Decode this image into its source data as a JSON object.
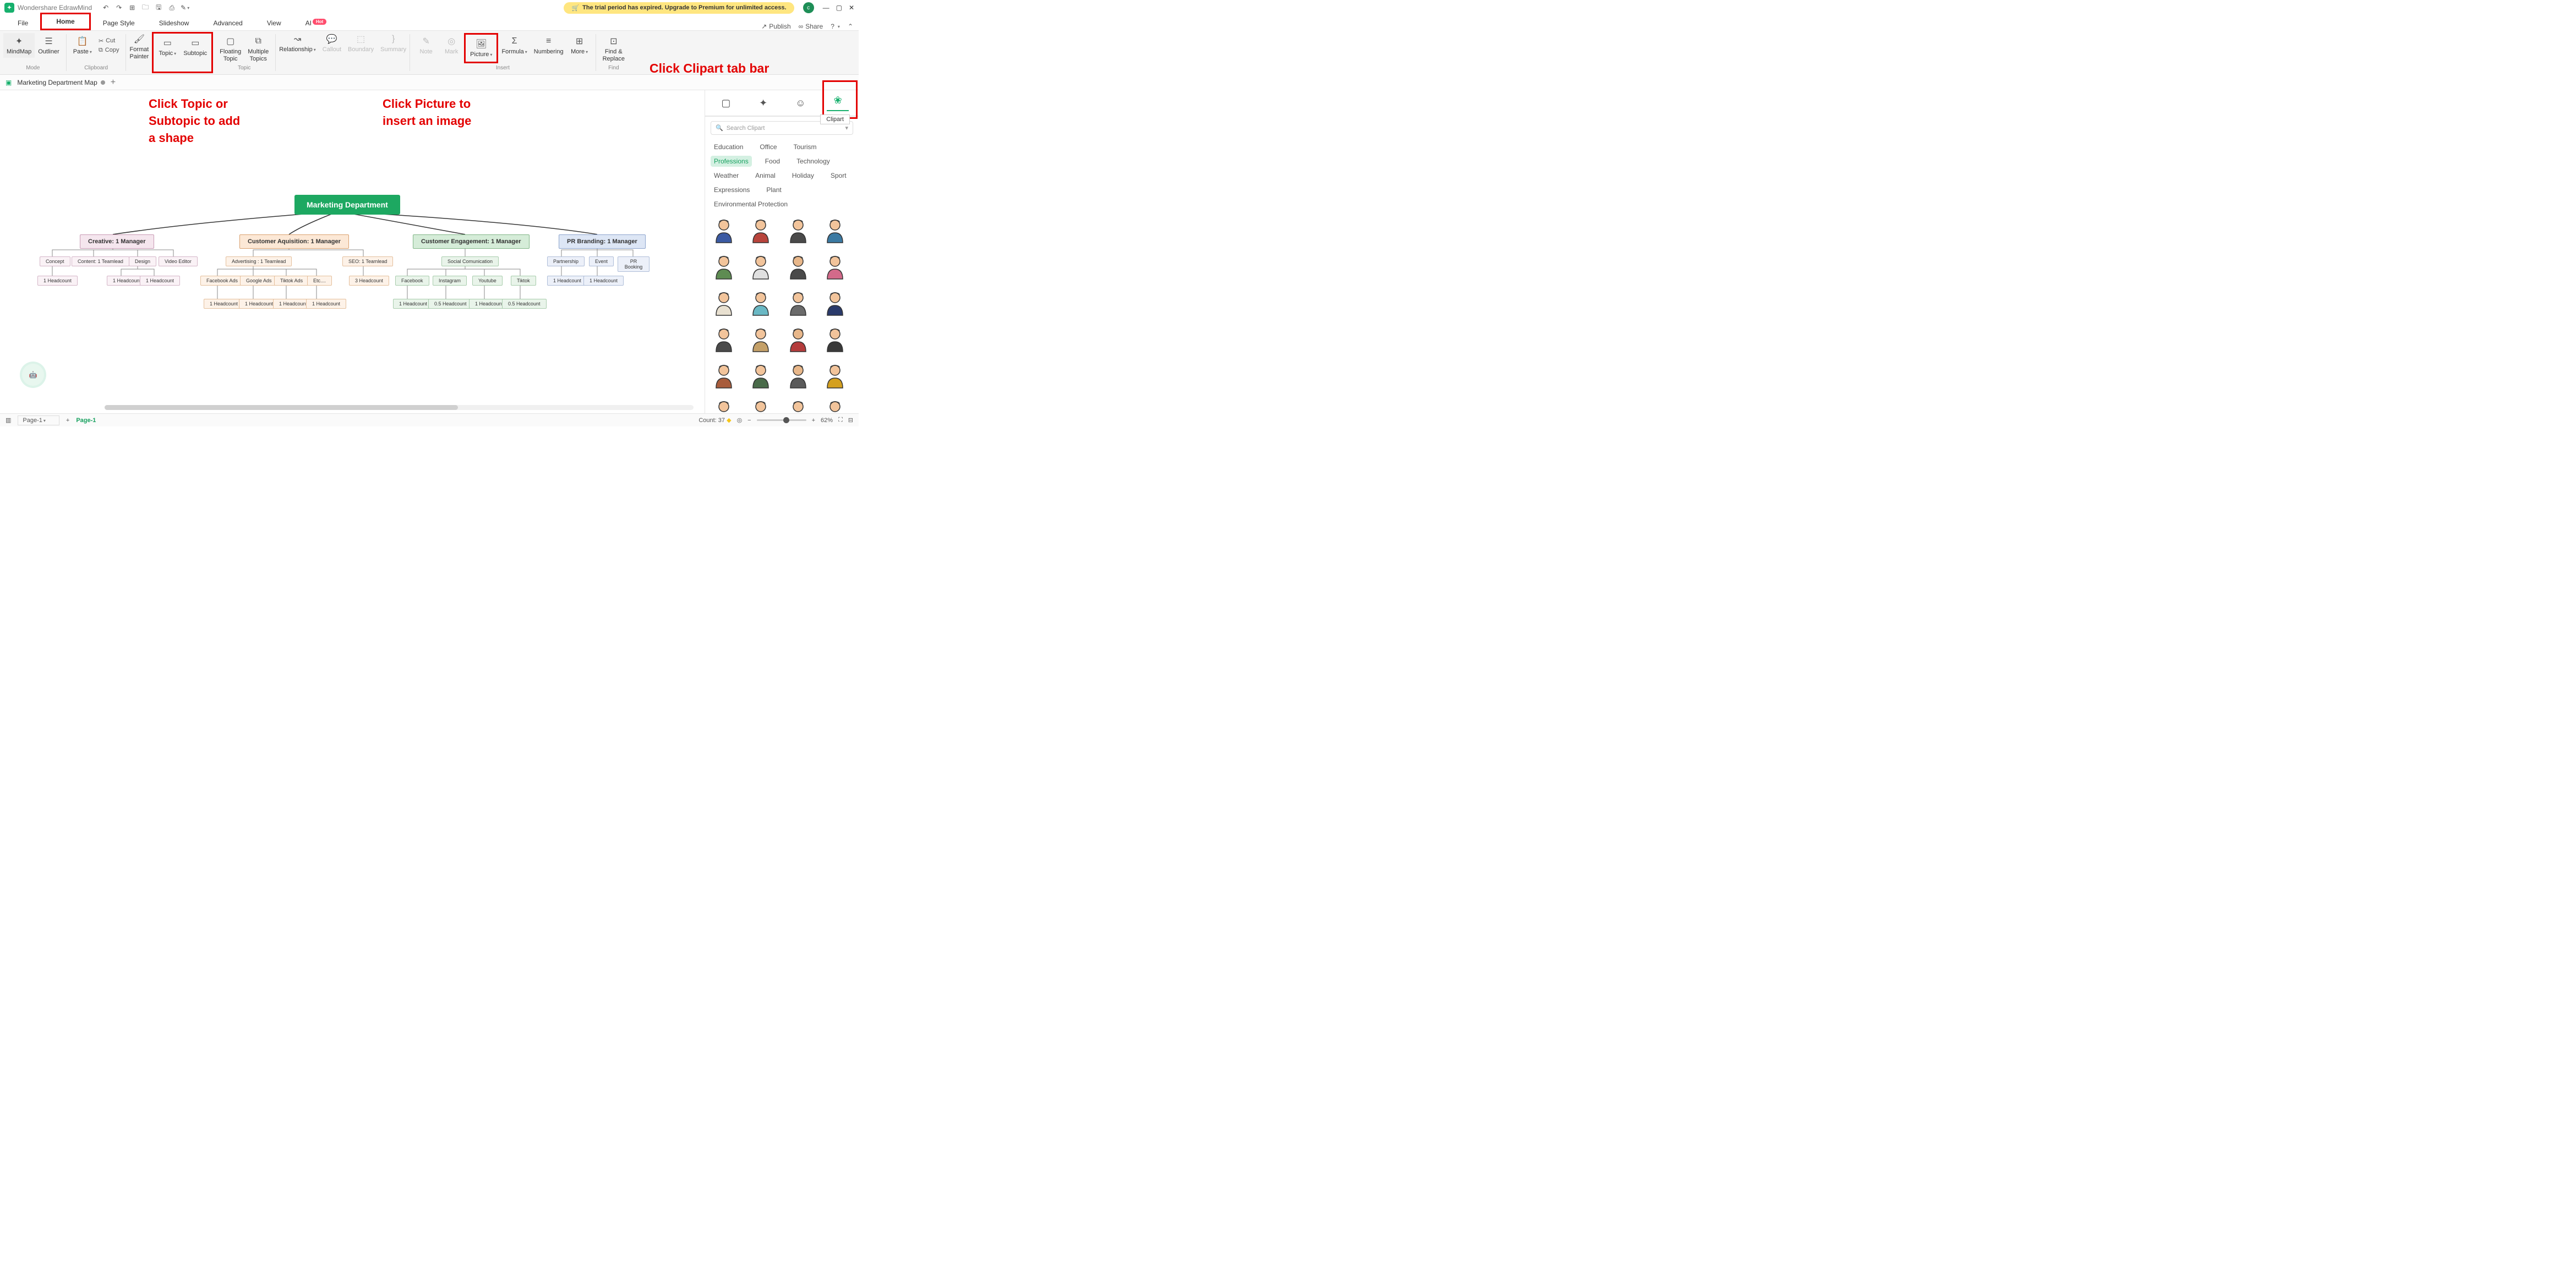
{
  "titlebar": {
    "app": "Wondershare EdrawMind",
    "avatar": "c",
    "trial": "The trial period has expired. Upgrade to Premium for unlimited access."
  },
  "menu": {
    "file": "File",
    "home": "Home",
    "page_style": "Page Style",
    "slideshow": "Slideshow",
    "advanced": "Advanced",
    "view": "View",
    "ai": "AI",
    "hot": "Hot",
    "publish": "Publish",
    "share": "Share"
  },
  "ribbon": {
    "mindmap": "MindMap",
    "outliner": "Outliner",
    "mode": "Mode",
    "paste": "Paste",
    "cut": "Cut",
    "copy": "Copy",
    "clipboard": "Clipboard",
    "format_painter": "Format\nPainter",
    "topic": "Topic",
    "subtopic": "Subtopic",
    "floating": "Floating\nTopic",
    "multiple": "Multiple\nTopics",
    "topic_group": "Topic",
    "relationship": "Relationship",
    "callout": "Callout",
    "boundary": "Boundary",
    "summary": "Summary",
    "note": "Note",
    "mark": "Mark",
    "picture": "Picture",
    "formula": "Formula",
    "numbering": "Numbering",
    "more": "More",
    "insert": "Insert",
    "find_replace": "Find &\nReplace",
    "find": "Find"
  },
  "doc_tabs": {
    "name": "Marketing Department Map"
  },
  "annotations": {
    "a1": "Click Topic or Subtopic to add a shape",
    "a2": "Click Picture to insert an image",
    "a3": "Click Clipart tab bar"
  },
  "mindmap": {
    "root": "Marketing Department",
    "mgr": {
      "creative": "Creative: 1 Manager",
      "cust_aq": "Customer Aquisition: 1 Manager",
      "cust_en": "Customer Engagement: 1 Manager",
      "pr": "PR Branding: 1 Manager"
    },
    "sub": {
      "concept": "Concept",
      "content": "Content: 1 Teamlead",
      "design": "Design",
      "video": "Video Editor",
      "hc1": "1 Headcount",
      "advertising": "Advertising : 1 Teamlead",
      "seo": "SEO: 1 Teamlead",
      "fb_ads": "Facebook Ads",
      "google_ads": "Google Ads",
      "tiktok_ads": "Tiktok Ads",
      "etc": "Etc....",
      "hc3": "3 Headcount",
      "social": "Social Comunication",
      "facebook": "Facebook",
      "instagram": "Instagram",
      "youtube": "Youtube",
      "tiktok": "Tiktok",
      "hc05": "0.5 Headcount",
      "partnership": "Partnership",
      "event": "Event",
      "prbook": "PR Booking"
    }
  },
  "right_panel": {
    "tooltip": "Clipart",
    "search_ph": "Search Clipart",
    "cats": {
      "education": "Education",
      "office": "Office",
      "tourism": "Tourism",
      "professions": "Professions",
      "food": "Food",
      "technology": "Technology",
      "weather": "Weather",
      "animal": "Animal",
      "holiday": "Holiday",
      "sport": "Sport",
      "expressions": "Expressions",
      "plant": "Plant",
      "env": "Environmental Protection"
    }
  },
  "statusbar": {
    "page_sel": "Page-1",
    "page_tab": "Page-1",
    "count": "Count: 37",
    "zoom": "62%"
  }
}
